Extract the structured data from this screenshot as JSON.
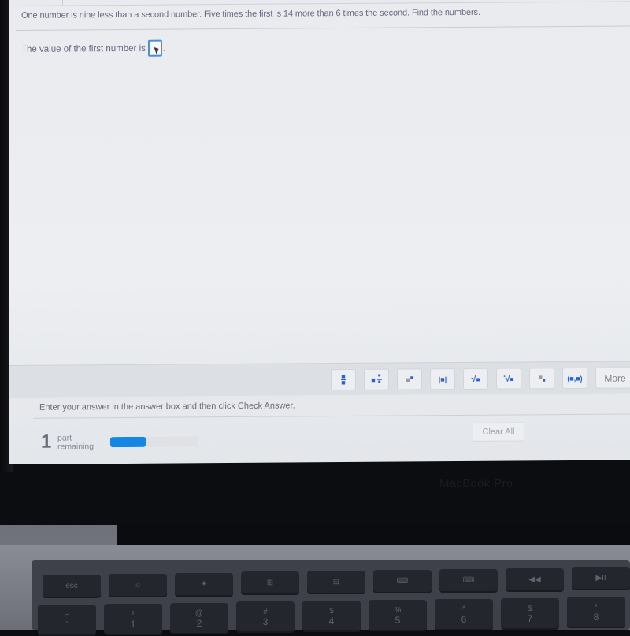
{
  "question": {
    "text": "One number is nine less than a second number. Five times the first is 14 more than 6 times the second. Find the numbers.",
    "answer_prompt": "The value of the first number is",
    "answer_value": "",
    "answer_suffix": "."
  },
  "toolbar": {
    "buttons": [
      {
        "icon": "fraction-icon",
        "glyph": "▪̲▪"
      },
      {
        "icon": "mixed-number-icon",
        "glyph": "▪▪̲"
      },
      {
        "icon": "exponent-icon",
        "glyph": "▪'"
      },
      {
        "icon": "absolute-value-icon",
        "glyph": "|▪|"
      },
      {
        "icon": "square-root-icon",
        "glyph": "√▪"
      },
      {
        "icon": "nth-root-icon",
        "glyph": "∛▪"
      },
      {
        "icon": "subscript-icon",
        "glyph": "▪."
      },
      {
        "icon": "ordered-pair-icon",
        "glyph": "(▪,▪)"
      }
    ],
    "more_label": "More"
  },
  "instructions": "Enter your answer in the answer box and then click Check Answer.",
  "status": {
    "parts_count": "1",
    "parts_label_line1": "part",
    "parts_label_line2": "remaining",
    "progress_percent": 40,
    "progress_color": "#1386e6"
  },
  "clear_all_label": "Clear All",
  "device": {
    "label": "MacBook Pro",
    "keyboard": {
      "fn_row": [
        "esc",
        "☼",
        "☀",
        "⊞",
        "⊟",
        "⌨",
        "⌨",
        "◀◀",
        "▶II"
      ],
      "number_row": [
        {
          "top": "~",
          "bottom": "`"
        },
        {
          "top": "!",
          "bottom": "1"
        },
        {
          "top": "@",
          "bottom": "2"
        },
        {
          "top": "#",
          "bottom": "3"
        },
        {
          "top": "$",
          "bottom": "4"
        },
        {
          "top": "%",
          "bottom": "5"
        },
        {
          "top": "^",
          "bottom": "6"
        },
        {
          "top": "&",
          "bottom": "7"
        },
        {
          "top": "*",
          "bottom": "8"
        }
      ]
    }
  }
}
